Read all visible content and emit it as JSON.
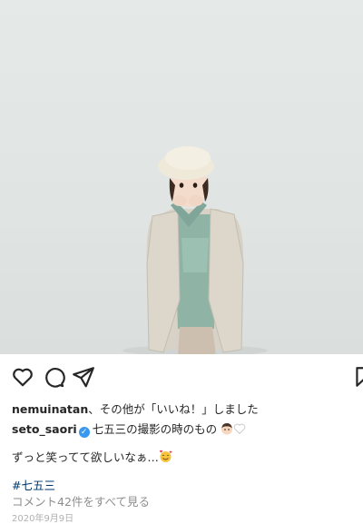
{
  "post": {
    "likes_user": "nemuinatan",
    "likes_suffix": "、その他が「いいね！」しました",
    "author": "seto_saori",
    "verified_glyph": "✓",
    "caption_text": "七五三の撮影の時のもの",
    "caption_emojis": [
      "boy-face-emoji",
      "white-heart-emoji"
    ],
    "body_text": "ずっと笑ってて欲しいなぁ…",
    "body_emoji": "smiling-face-with-hearts-emoji",
    "hashtag": "#七五三",
    "comments_link": "コメント42件をすべて見る",
    "date": "2020年9月9日"
  },
  "icons": {
    "like": "heart-icon",
    "comment": "comment-icon",
    "share": "send-icon",
    "save": "bookmark-icon"
  },
  "colors": {
    "text": "#262626",
    "link": "#00376b",
    "muted": "#8e8e8e",
    "verified": "#3897f0"
  }
}
